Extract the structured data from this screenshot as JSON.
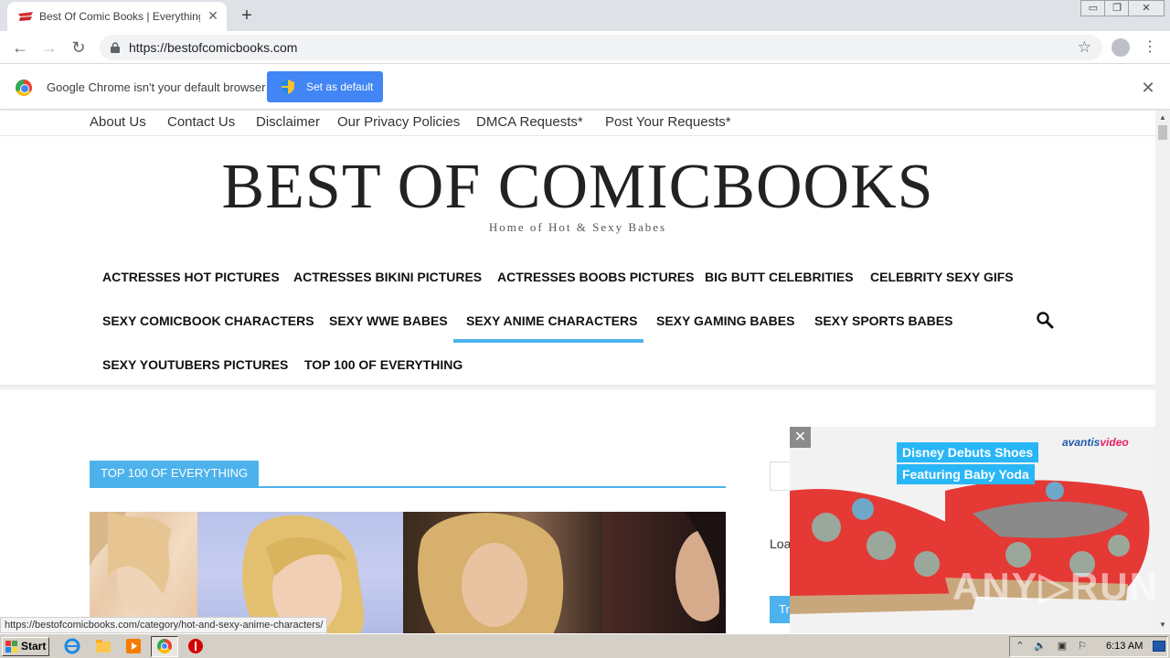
{
  "browser": {
    "tab": {
      "title": "Best Of Comic Books | Everything Ab",
      "close": "✕"
    },
    "new_tab": "+",
    "window_controls": {
      "minimize": "▭",
      "restore": "❐",
      "close": "✕"
    },
    "nav": {
      "back": "←",
      "forward": "→",
      "reload": "↻"
    },
    "url": "https://bestofcomicbooks.com",
    "star": "☆",
    "menu": "⋮"
  },
  "infobar": {
    "message": "Google Chrome isn't your default browser",
    "button": "Set as default",
    "close": "✕"
  },
  "site": {
    "top_links": [
      "About Us",
      "Contact Us",
      "Disclaimer",
      "Our Privacy Policies",
      "DMCA Requests*",
      "Post Your Requests*"
    ],
    "title": "BEST OF COMICBOOKS",
    "tagline": "Home of Hot & Sexy Babes",
    "main_nav": [
      [
        "ACTRESSES HOT PICTURES",
        "ACTRESSES BIKINI PICTURES",
        "ACTRESSES BOOBS PICTURES",
        "BIG BUTT CELEBRITIES",
        "CELEBRITY SEXY GIFS"
      ],
      [
        "SEXY COMICBOOK CHARACTERS",
        "SEXY WWE BABES",
        "SEXY ANIME CHARACTERS",
        "SEXY GAMING BABES",
        "SEXY SPORTS BABES"
      ],
      [
        "SEXY YOUTUBERS PICTURES",
        "TOP 100 OF EVERYTHING"
      ]
    ],
    "active_nav": "SEXY ANIME CHARACTERS",
    "section_label": "TOP 100 OF EVERYTHING",
    "sidebar": {
      "loading": "Loa",
      "button": "Tr"
    },
    "accent_color": "#4db2ec"
  },
  "ad": {
    "close": "✕",
    "brand_main": "avantis",
    "brand_accent": "video",
    "headline": [
      "Disney Debuts Shoes",
      "Featuring Baby Yoda"
    ],
    "watermark": "ANY▷RUN"
  },
  "status_url": "https://bestofcomicbooks.com/category/hot-and-sexy-anime-characters/",
  "taskbar": {
    "start": "Start",
    "clock": "6:13 AM"
  },
  "scrollbar": {
    "up": "▲",
    "down": "▼"
  }
}
